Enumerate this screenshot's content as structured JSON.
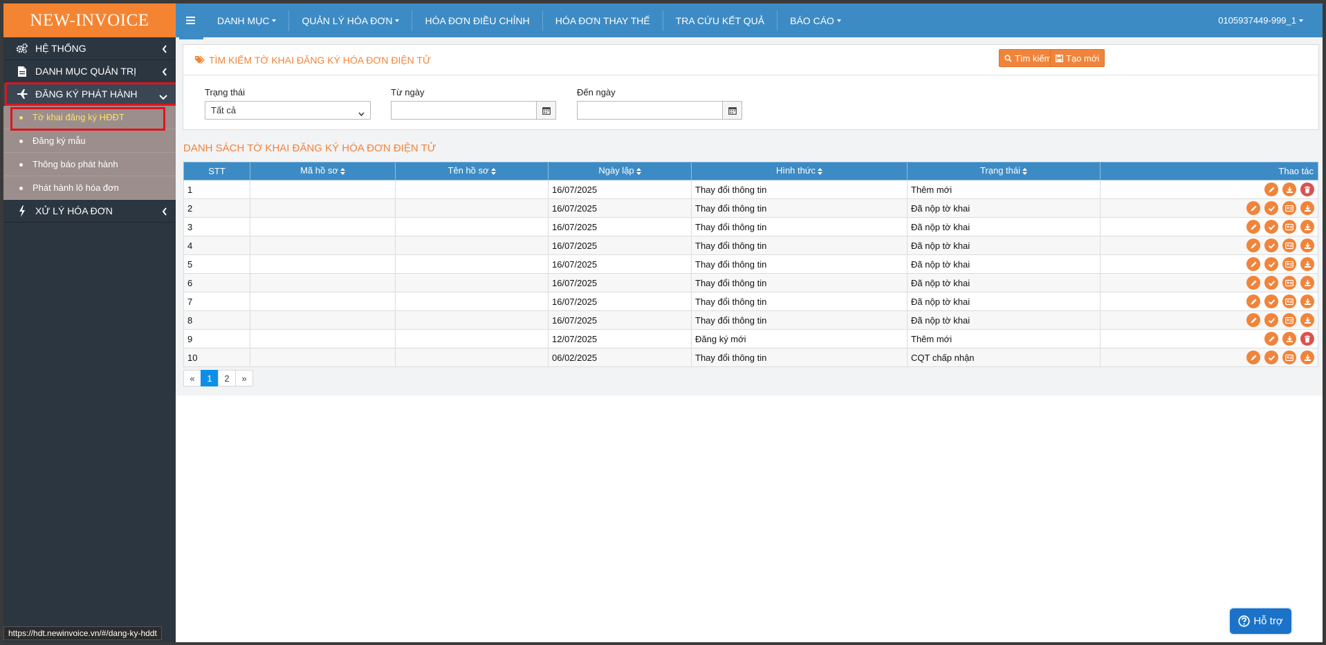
{
  "brand": "NEW-INVOICE",
  "sidebar": {
    "items": [
      {
        "label": "HỆ THỐNG",
        "icon": "gears-icon"
      },
      {
        "label": "DANH MỤC QUẢN TRỊ",
        "icon": "document-icon"
      },
      {
        "label": "ĐĂNG KÝ PHÁT HÀNH",
        "icon": "plane-icon"
      },
      {
        "label": "XỬ LÝ HÓA ĐƠN",
        "icon": "bolt-icon"
      }
    ],
    "submenu": [
      "Tờ khai đăng ký HĐĐT",
      "Đăng ký mẫu",
      "Thông báo phát hành",
      "Phát hành lô hóa đơn"
    ]
  },
  "nav": {
    "items": [
      "DANH MỤC",
      "QUẢN LÝ HÓA ĐƠN",
      "HÓA ĐƠN ĐIỀU CHỈNH",
      "HÓA ĐƠN THAY THẾ",
      "TRA CỨU KẾT QUẢ",
      "BÁO CÁO"
    ],
    "user": "0105937449-999_1"
  },
  "search": {
    "title": "TÌM KIẾM TỜ KHAI ĐĂNG KÝ HÓA ĐƠN ĐIỆN TỬ",
    "search_button": "Tìm kiếm",
    "create_button": "Tạo mới",
    "status_label": "Trạng thái",
    "status_value": "Tất cả",
    "from_label": "Từ ngày",
    "to_label": "Đến ngày"
  },
  "list": {
    "title": "DANH SÁCH TỜ KHAI ĐĂNG KÝ HÓA ĐƠN ĐIỆN TỬ",
    "columns": [
      "STT",
      "Mã hồ sơ",
      "Tên hồ sơ",
      "Ngày lập",
      "Hình thức",
      "Trạng thái",
      "Thao tác"
    ],
    "rows": [
      {
        "stt": "1",
        "ma": "",
        "ten": "",
        "ngay": "16/07/2025",
        "hinhthuc": "Thay đổi thông tin",
        "trangthai": "Thêm mới",
        "actions": [
          "edit",
          "download",
          "delete"
        ]
      },
      {
        "stt": "2",
        "ma": "",
        "ten": "",
        "ngay": "16/07/2025",
        "hinhthuc": "Thay đổi thông tin",
        "trangthai": "Đã nộp tờ khai",
        "actions": [
          "edit",
          "check",
          "id",
          "download"
        ]
      },
      {
        "stt": "3",
        "ma": "",
        "ten": "",
        "ngay": "16/07/2025",
        "hinhthuc": "Thay đổi thông tin",
        "trangthai": "Đã nộp tờ khai",
        "actions": [
          "edit",
          "check",
          "id",
          "download"
        ]
      },
      {
        "stt": "4",
        "ma": "",
        "ten": "",
        "ngay": "16/07/2025",
        "hinhthuc": "Thay đổi thông tin",
        "trangthai": "Đã nộp tờ khai",
        "actions": [
          "edit",
          "check",
          "id",
          "download"
        ]
      },
      {
        "stt": "5",
        "ma": "",
        "ten": "",
        "ngay": "16/07/2025",
        "hinhthuc": "Thay đổi thông tin",
        "trangthai": "Đã nộp tờ khai",
        "actions": [
          "edit",
          "check",
          "id",
          "download"
        ]
      },
      {
        "stt": "6",
        "ma": "",
        "ten": "",
        "ngay": "16/07/2025",
        "hinhthuc": "Thay đổi thông tin",
        "trangthai": "Đã nộp tờ khai",
        "actions": [
          "edit",
          "check",
          "id",
          "download"
        ]
      },
      {
        "stt": "7",
        "ma": "",
        "ten": "",
        "ngay": "16/07/2025",
        "hinhthuc": "Thay đổi thông tin",
        "trangthai": "Đã nộp tờ khai",
        "actions": [
          "edit",
          "check",
          "id",
          "download"
        ]
      },
      {
        "stt": "8",
        "ma": "",
        "ten": "",
        "ngay": "16/07/2025",
        "hinhthuc": "Thay đổi thông tin",
        "trangthai": "Đã nộp tờ khai",
        "actions": [
          "edit",
          "check",
          "id",
          "download"
        ]
      },
      {
        "stt": "9",
        "ma": "",
        "ten": "",
        "ngay": "12/07/2025",
        "hinhthuc": "Đăng ký mới",
        "trangthai": "Thêm mới",
        "actions": [
          "edit",
          "download",
          "delete"
        ]
      },
      {
        "stt": "10",
        "ma": "",
        "ten": "",
        "ngay": "06/02/2025",
        "hinhthuc": "Thay đổi thông tin",
        "trangthai": "CQT chấp nhận",
        "actions": [
          "edit",
          "check",
          "id",
          "download"
        ]
      }
    ]
  },
  "pager": {
    "prev": "«",
    "pages": [
      "1",
      "2"
    ],
    "current": "1",
    "next": "»"
  },
  "support": "Hỗ trợ",
  "status_url": "https://hdt.newinvoice.vn/#/dang-ky-hddt",
  "colors": {
    "brand": "#f58432",
    "topbar": "#3d8bc4",
    "sidebar": "#2b3641",
    "accent": "#f0843a",
    "highlight": "#e0141c"
  }
}
